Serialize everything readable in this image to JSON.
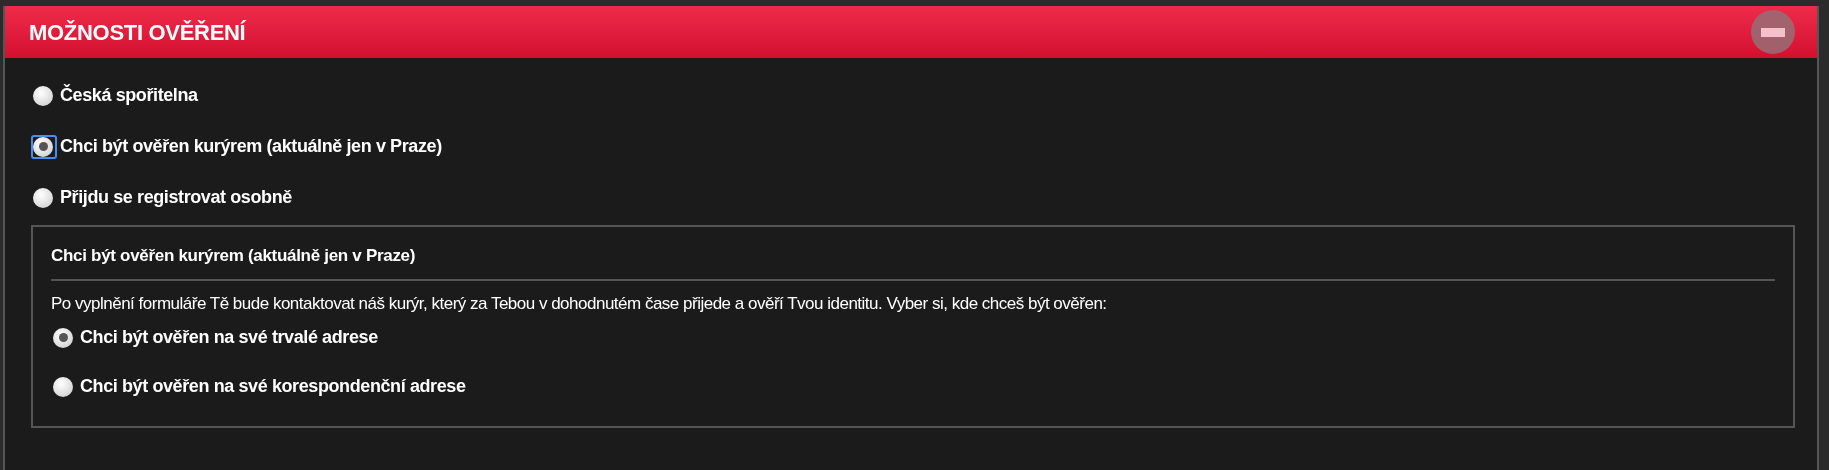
{
  "panel": {
    "title": "MOŽNOSTI OVĚŘENÍ",
    "options": [
      {
        "label": "Česká spořitelna",
        "selected": false,
        "focused": false
      },
      {
        "label": "Chci být ověřen kurýrem (aktuálně jen v Praze)",
        "selected": true,
        "focused": true
      },
      {
        "label": "Přijdu se registrovat osobně",
        "selected": false,
        "focused": false
      }
    ],
    "detail": {
      "title": "Chci být ověřen kurýrem (aktuálně jen v Praze)",
      "description": "Po vyplnění formuláře Tě bude kontaktovat náš kurýr, který za Tebou v dohodnutém čase přijede a ověří Tvou identitu. Vyber si, kde chceš být ověřen:",
      "options": [
        {
          "label": "Chci být ověřen na své trvalé adrese",
          "selected": true,
          "focused": false
        },
        {
          "label": "Chci být ověřen na své korespondenční adrese",
          "selected": false,
          "focused": false
        }
      ]
    }
  }
}
